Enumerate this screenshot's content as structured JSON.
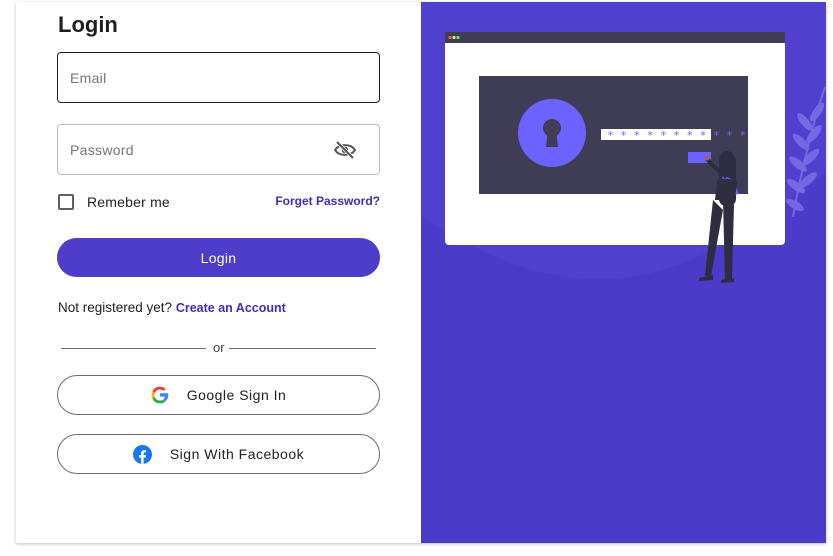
{
  "login": {
    "title": "Login",
    "email": {
      "placeholder": "Email",
      "value": ""
    },
    "password": {
      "placeholder": "Password",
      "value": ""
    },
    "remember_label": "Remeber me",
    "forgot_label": "Forget Password?",
    "submit_label": "Login",
    "register_prompt": "Not registered yet?",
    "register_link": "Create an Account",
    "divider_text": "or",
    "google_label": "Google Sign In",
    "facebook_label": "Sign With Facebook"
  },
  "illustration": {
    "password_dots": "* * * * * * * * * * *",
    "icons": [
      "window-dots-icon",
      "keyhole-lock-icon",
      "person-figure",
      "leaf-branch-icon"
    ]
  },
  "colors": {
    "accent": "#4e3ccb",
    "panel": "#4b3bc9",
    "link": "#3f2fb8",
    "facebook": "#1877f2"
  }
}
